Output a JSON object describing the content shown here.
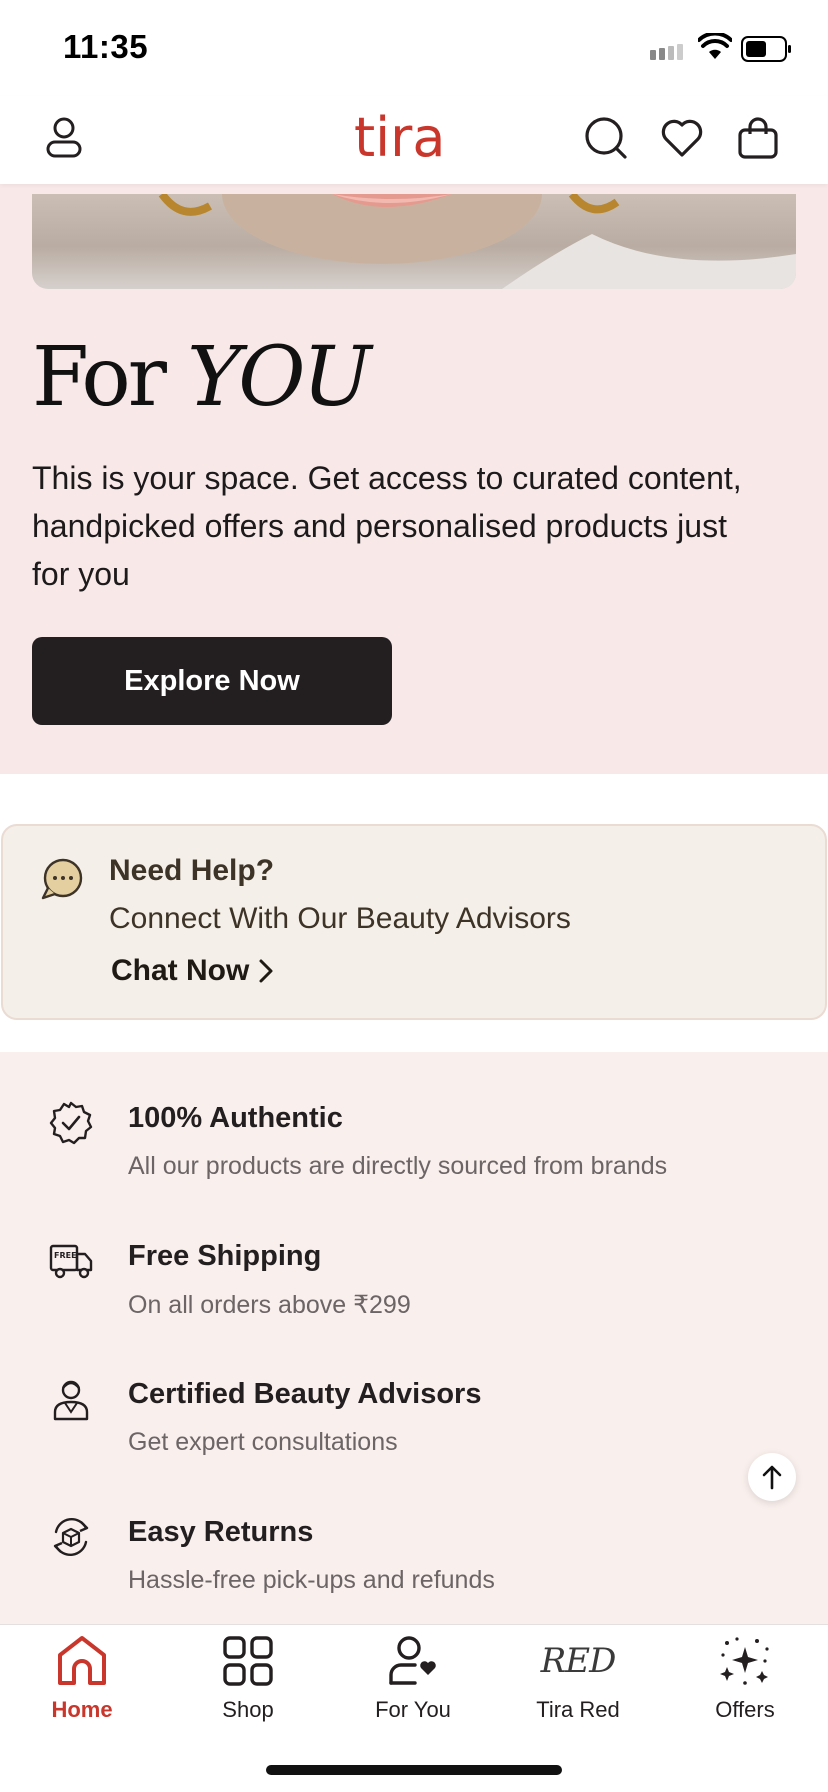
{
  "status_bar": {
    "time": "11:35"
  },
  "header": {
    "logo_text": "tira",
    "brand_color": "#c9372c"
  },
  "hero": {
    "title_for": "For",
    "title_you": "YOU",
    "description": "This is your space. Get access to curated content, handpicked offers and personalised products just for you",
    "cta_label": "Explore Now",
    "background": "#f8e8e8"
  },
  "help": {
    "title": "Need Help?",
    "subtitle": "Connect With Our Beauty Advisors",
    "link_label": "Chat Now"
  },
  "features": [
    {
      "icon": "authentic-badge-icon",
      "title": "100% Authentic",
      "desc": "All our products are directly sourced from brands"
    },
    {
      "icon": "free-shipping-truck-icon",
      "title": "Free Shipping",
      "desc": "On all orders above ₹299"
    },
    {
      "icon": "beauty-advisor-icon",
      "title": "Certified Beauty Advisors",
      "desc": "Get expert consultations"
    },
    {
      "icon": "easy-returns-icon",
      "title": "Easy Returns",
      "desc": "Hassle-free pick-ups and refunds"
    }
  ],
  "bottom_nav": {
    "items": [
      {
        "label": "Home",
        "icon": "home-icon",
        "active": true
      },
      {
        "label": "Shop",
        "icon": "grid-icon",
        "active": false
      },
      {
        "label": "For You",
        "icon": "person-heart-icon",
        "active": false
      },
      {
        "label": "Tira Red",
        "icon": "red-wordmark",
        "glyph": "RED",
        "active": false
      },
      {
        "label": "Offers",
        "icon": "sparkles-icon",
        "active": false
      }
    ]
  }
}
